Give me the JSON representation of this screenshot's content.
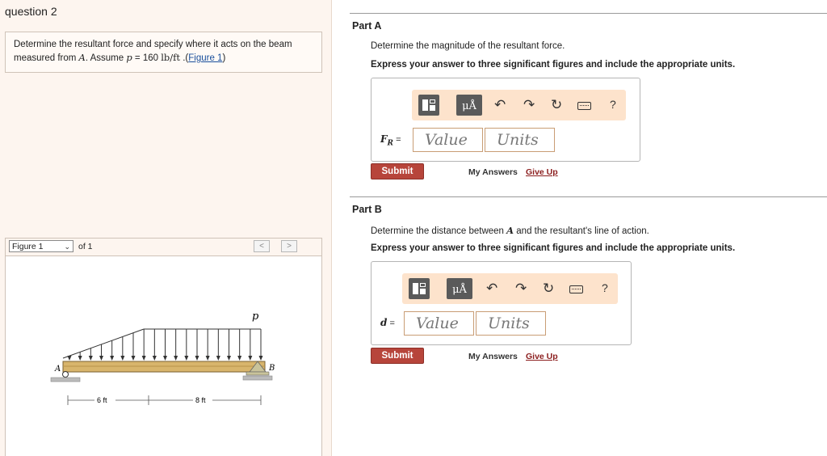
{
  "question": {
    "title": "question 2",
    "text_1": "Determine the resultant force and specify where it acts on the beam",
    "text_2": "measured from ",
    "point": "A",
    "text_3": ". Assume ",
    "var": "p",
    "eq": " = 160 ",
    "unit": "lb/ft",
    "text_4": " .(",
    "figure_link": "Figure 1",
    "text_5": ")"
  },
  "figure": {
    "selector_label": "Figure 1",
    "of_label": "of 1",
    "prev": "<",
    "next": ">",
    "label_p": "p",
    "label_A": "A",
    "label_B": "B",
    "dim_1": "6 ft",
    "dim_2": "8 ft"
  },
  "part_a": {
    "label": "Part A",
    "question": "Determine the magnitude of the resultant force.",
    "instruction": "Express your answer to three significant figures and include the appropriate units.",
    "var_main": "F",
    "var_sub": "R",
    "eq": " =",
    "value_placeholder": "Value",
    "units_placeholder": "Units",
    "submit": "Submit",
    "my_answers": "My Answers",
    "give_up": "Give Up"
  },
  "part_b": {
    "label": "Part B",
    "question_1": "Determine the distance between ",
    "point": "A",
    "question_2": " and the resultant's line of action.",
    "instruction": "Express your answer to three significant figures and include the appropriate units.",
    "var_main": "d",
    "eq": " =",
    "value_placeholder": "Value",
    "units_placeholder": "Units",
    "submit": "Submit",
    "my_answers": "My Answers",
    "give_up": "Give Up"
  },
  "toolbar": {
    "units_glyph": "μÅ",
    "undo": "↶",
    "redo": "↷",
    "reset": "↻",
    "help": "?"
  },
  "colors": {
    "left_bg": "#fdf5ef",
    "toolbar_bg": "#fde3cc",
    "submit_bg": "#b7453b",
    "give_up": "#8b1d1d",
    "beam": "#d8b56c"
  }
}
